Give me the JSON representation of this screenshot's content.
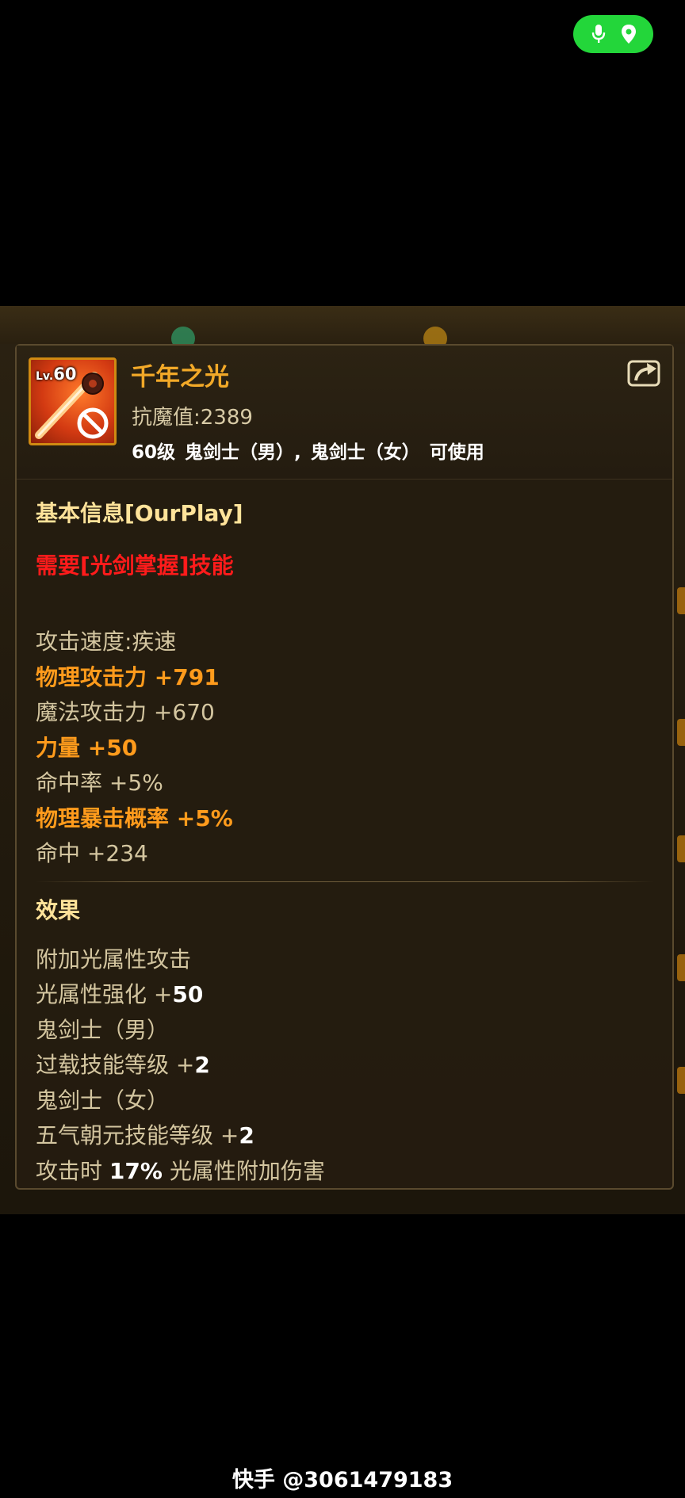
{
  "status_indicator": {
    "mic_icon": "microphone-icon",
    "location_icon": "location-pin-icon",
    "color": "#23d63a"
  },
  "item": {
    "level_prefix": "Lv.",
    "level": "60",
    "name": "千年之光",
    "resist_label": "抗魔值:2389",
    "usable": "60级 鬼剑士（男）, 鬼剑士（女） 可使用"
  },
  "basic": {
    "title": "基本信息[OurPlay]",
    "requirement": "需要[光剑掌握]技能",
    "stats": [
      {
        "label": "攻击速度:疾速",
        "value": "",
        "style": "tan"
      },
      {
        "label": "物理攻击力",
        "value": "+791",
        "style": "orange"
      },
      {
        "label": "魔法攻击力",
        "value": "+670",
        "style": "tan"
      },
      {
        "label": "力量",
        "value": "+50",
        "style": "orange"
      },
      {
        "label": "命中率",
        "value": "+5%",
        "style": "tan"
      },
      {
        "label": "物理暴击概率",
        "value": "+5%",
        "style": "orange"
      },
      {
        "label": "命中",
        "value": "+234",
        "style": "tan"
      }
    ]
  },
  "effects": {
    "title": "效果",
    "lines": [
      {
        "text": "附加光属性攻击",
        "value": ""
      },
      {
        "text": "光属性强化 +",
        "value": "50"
      },
      {
        "text": "鬼剑士（男）",
        "value": ""
      },
      {
        "text": "过载技能等级 +",
        "value": "2"
      },
      {
        "text": "鬼剑士（女）",
        "value": ""
      },
      {
        "text": "五气朝元技能等级 +",
        "value": "2"
      },
      {
        "text": "攻击时 ",
        "value": "17%",
        "suffix": " 光属性附加伤害"
      }
    ]
  },
  "footer": {
    "text": "快手 @3061479183"
  }
}
